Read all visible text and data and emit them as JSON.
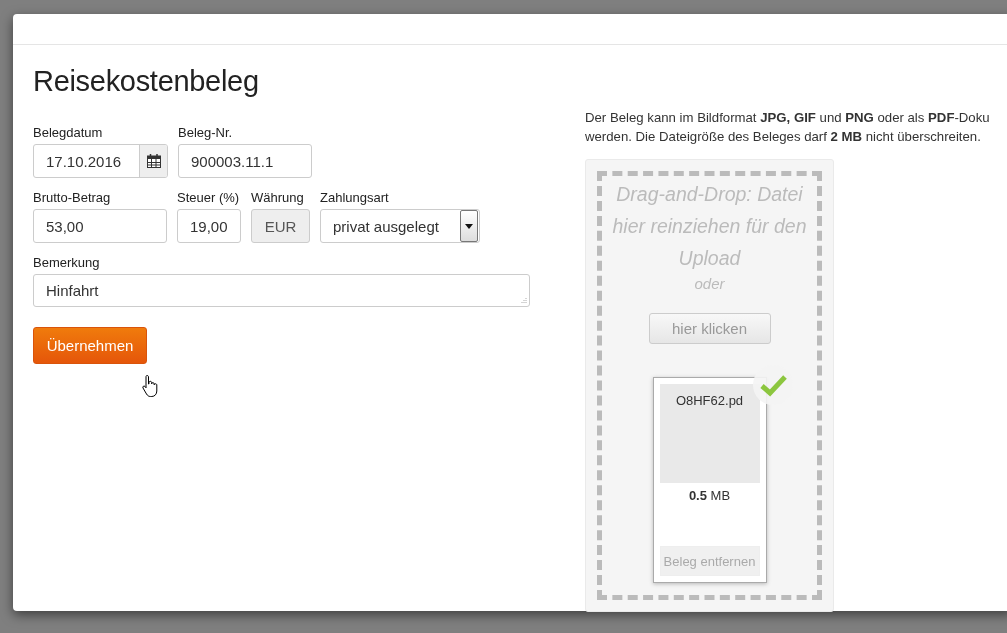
{
  "dialog": {
    "title": "Reisekostenbeleg"
  },
  "form_rows": [
    [
      {
        "kind": "date",
        "label": "Belegdatum",
        "value": "17.10.2016",
        "disabled": false
      },
      {
        "kind": "text",
        "label": "Beleg-Nr.",
        "value": "900003.11.1",
        "disabled": false
      }
    ],
    [
      {
        "kind": "text",
        "label": "Brutto-Betrag",
        "value": "53,00",
        "disabled": false
      },
      {
        "kind": "text",
        "label": "Steuer (%)",
        "value": "19,00",
        "disabled": false
      },
      {
        "kind": "text",
        "label": "Währung",
        "value": "EUR",
        "disabled": true
      },
      {
        "kind": "select",
        "label": "Zahlungsart",
        "value": "privat ausgelegt",
        "disabled": false
      }
    ],
    [
      {
        "kind": "textarea",
        "label": "Bemerkung",
        "value": "Hinfahrt",
        "disabled": false
      }
    ]
  ],
  "submit_button": "Übernehmen",
  "info_lines": [
    "Der Beleg kann im Bildformat **JPG, GIF** und **PNG** oder als **PDF**-Doku",
    "werden. Die Dateigröße des Beleges darf **2 MB** nicht überschreiten."
  ],
  "dropzone": {
    "hint": "Drag-and-Drop: Datei hier reinziehen für den Upload",
    "or": "oder",
    "button": "hier klicken",
    "file": {
      "name": "O8HF62.pd",
      "size": "**0.5** MB",
      "uploaded": true,
      "remove_button": "Beleg entfernen"
    }
  }
}
